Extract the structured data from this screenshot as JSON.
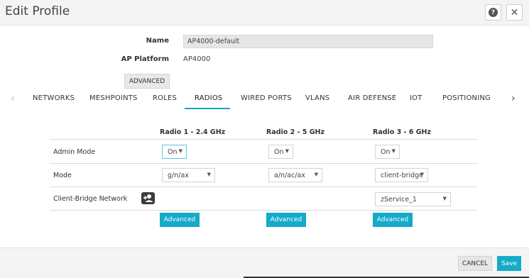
{
  "dialog": {
    "title": "Edit Profile",
    "help_icon": "help-icon",
    "close_icon": "close-icon"
  },
  "form": {
    "name_label": "Name",
    "name_value": "AP4000-default",
    "platform_label": "AP Platform",
    "platform_value": "AP4000",
    "advanced_label": "ADVANCED"
  },
  "tabs": [
    {
      "label": "NETWORKS",
      "active": false
    },
    {
      "label": "MESHPOINTS",
      "active": false
    },
    {
      "label": "ROLES",
      "active": false
    },
    {
      "label": "RADIOS",
      "active": true
    },
    {
      "label": "WIRED PORTS",
      "active": false
    },
    {
      "label": "VLANS",
      "active": false
    },
    {
      "label": "AIR DEFENSE",
      "active": false
    },
    {
      "label": "IOT",
      "active": false
    },
    {
      "label": "POSITIONING",
      "active": false
    }
  ],
  "radios": {
    "columns": [
      "Radio 1 - 2.4 GHz",
      "Radio 2 - 5 GHz",
      "Radio 3 - 6 GHz"
    ],
    "rows": {
      "admin_mode_label": "Admin Mode",
      "mode_label": "Mode",
      "client_bridge_label": "Client-Bridge Network"
    },
    "admin_mode": [
      "On",
      "On",
      "On"
    ],
    "mode": [
      "g/n/ax",
      "a/n/ac/ax",
      "client-bridge"
    ],
    "client_bridge_network": "zService_1",
    "advanced_button_label": "Advanced"
  },
  "footer": {
    "cancel_label": "CANCEL",
    "save_label": "Save"
  },
  "colors": {
    "accent": "#14aac9",
    "header_bg": "#f4f4f4"
  }
}
